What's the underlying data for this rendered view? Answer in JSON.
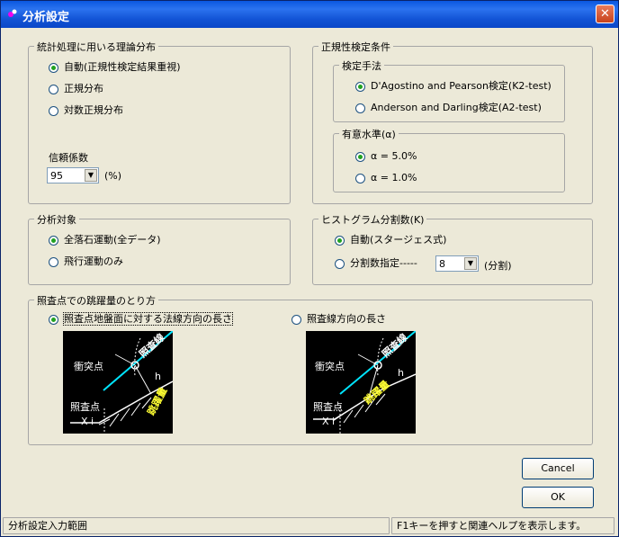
{
  "window": {
    "title": "分析設定",
    "close_label": "✕"
  },
  "groups": {
    "dist": {
      "legend": "統計処理に用いる理論分布",
      "options": [
        "自動(正規性検定結果重視)",
        "正規分布",
        "対数正規分布"
      ],
      "selected": 0,
      "confidence_label": "信頼係数",
      "confidence_value": "95",
      "confidence_unit": "(%)"
    },
    "normality": {
      "legend": "正規性検定条件",
      "method": {
        "legend": "検定手法",
        "options": [
          "D'Agostino and Pearson検定(K2-test)",
          "Anderson and Darling検定(A2-test)"
        ],
        "selected": 0
      },
      "level": {
        "legend": "有意水準(α)",
        "options": [
          "α = 5.0%",
          "α = 1.0%"
        ],
        "selected": 0
      }
    },
    "target": {
      "legend": "分析対象",
      "options": [
        "全落石運動(全データ)",
        "飛行運動のみ"
      ],
      "selected": 0
    },
    "histogram": {
      "legend": "ヒストグラム分割数(K)",
      "options": [
        "自動(スタージェス式)",
        "分割数指定-----"
      ],
      "selected": 0,
      "count_value": "8",
      "count_unit": "(分割)"
    },
    "jump": {
      "legend": "照査点での跳躍量のとり方",
      "options": [
        "照査点地盤面に対する法線方向の長さ",
        "照査線方向の長さ"
      ],
      "selected": 0,
      "diagram": {
        "check_line": "照査線",
        "impact_point": "衝突点",
        "jump_amount": "跳躍量",
        "h_label": "h",
        "check_point": "照査点",
        "xi_label": "X i"
      }
    }
  },
  "buttons": {
    "cancel": "Cancel",
    "ok": "OK"
  },
  "status": {
    "left": "分析設定入力範囲",
    "right": "F1キーを押すと関連ヘルプを表示します。"
  }
}
